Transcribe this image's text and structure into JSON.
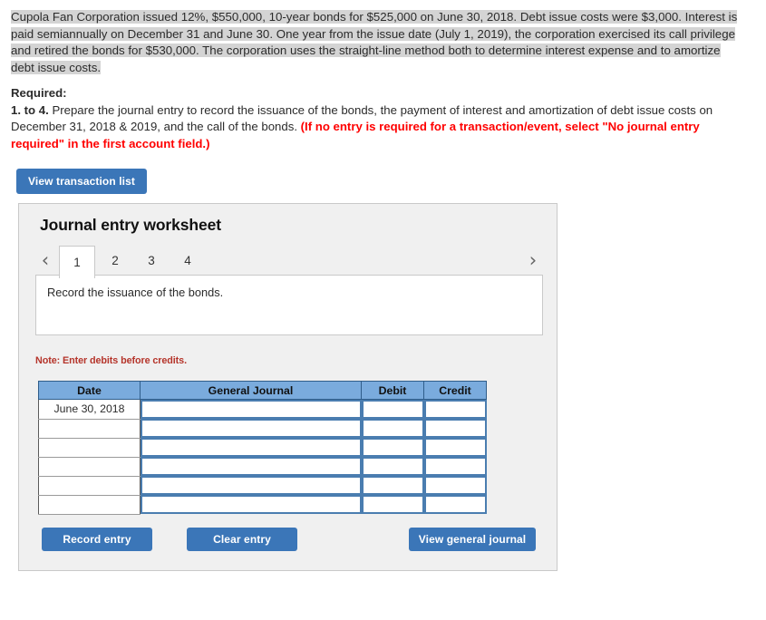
{
  "problem": {
    "text": "Cupola Fan Corporation issued 12%, $550,000, 10-year bonds for $525,000 on June 30, 2018. Debt issue costs were $3,000. Interest is paid semiannually on December 31 and June 30. One year from the issue date (July 1, 2019), the corporation exercised its call privilege and retired the bonds for $530,000. The corporation uses the straight-line method both to determine interest expense and to amortize debt issue costs."
  },
  "required": {
    "heading": "Required:",
    "item_number": "1. to 4.",
    "body": " Prepare the journal entry to record the issuance of the bonds, the payment of interest and amortization of debt issue costs on December 31, 2018 & 2019, and the call of the bonds. ",
    "red_note": "(If no entry is required for a transaction/event, select \"No journal entry required\" in the first account field.)"
  },
  "toolbar": {
    "view_transaction_list": "View transaction list"
  },
  "worksheet": {
    "title": "Journal entry worksheet",
    "prev_arrow": "‹",
    "next_arrow": "›",
    "tabs": [
      {
        "label": "1",
        "active": true
      },
      {
        "label": "2",
        "active": false
      },
      {
        "label": "3",
        "active": false
      },
      {
        "label": "4",
        "active": false
      }
    ],
    "description": "Record the issuance of the bonds.",
    "note": "Note: Enter debits before credits.",
    "table": {
      "headers": [
        "Date",
        "General Journal",
        "Debit",
        "Credit"
      ],
      "rows": [
        {
          "date": "June 30, 2018",
          "general_journal": "",
          "debit": "",
          "credit": ""
        },
        {
          "date": "",
          "general_journal": "",
          "debit": "",
          "credit": ""
        },
        {
          "date": "",
          "general_journal": "",
          "debit": "",
          "credit": ""
        },
        {
          "date": "",
          "general_journal": "",
          "debit": "",
          "credit": ""
        },
        {
          "date": "",
          "general_journal": "",
          "debit": "",
          "credit": ""
        },
        {
          "date": "",
          "general_journal": "",
          "debit": "",
          "credit": ""
        }
      ]
    },
    "buttons": {
      "record_entry": "Record entry",
      "clear_entry": "Clear entry",
      "view_general_journal": "View general journal"
    }
  },
  "colors": {
    "button_blue": "#3b76b8",
    "table_header_blue": "#7aabdd",
    "note_red": "#b5342a",
    "required_red": "#ff0000",
    "panel_gray": "#f0f0f0",
    "highlight_gray": "#d4d4d4",
    "input_border_blue": "#4a7db0"
  }
}
